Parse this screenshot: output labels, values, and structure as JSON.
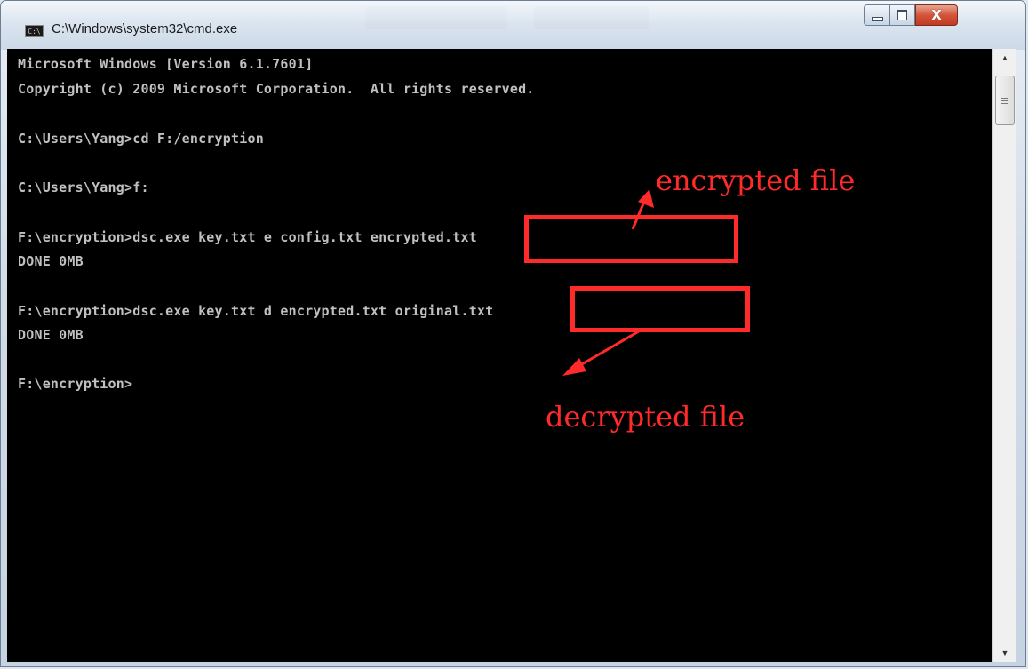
{
  "window": {
    "title": "C:\\Windows\\system32\\cmd.exe",
    "icon": "cmd-icon",
    "controls": {
      "minimize": "minimize-icon",
      "maximize": "maximize-icon",
      "close": "close-icon",
      "close_glyph": "X"
    }
  },
  "console": {
    "lines": [
      "Microsoft Windows [Version 6.1.7601]",
      "Copyright (c) 2009 Microsoft Corporation.  All rights reserved.",
      "C:\\Users\\Yang>cd F:/encryption",
      "C:\\Users\\Yang>f:",
      "F:\\encryption>dsc.exe key.txt e config.txt encrypted.txt",
      "DONE 0MB",
      "F:\\encryption>dsc.exe key.txt d encrypted.txt original.txt",
      "DONE 0MB",
      "F:\\encryption>"
    ]
  },
  "annotations": {
    "encrypted_label": "encrypted file",
    "decrypted_label": "decrypted file",
    "color": "#ff2a2a"
  },
  "colors": {
    "console_bg": "#000000",
    "console_text": "#c0c0c0",
    "annotation": "#ff2a2a"
  }
}
